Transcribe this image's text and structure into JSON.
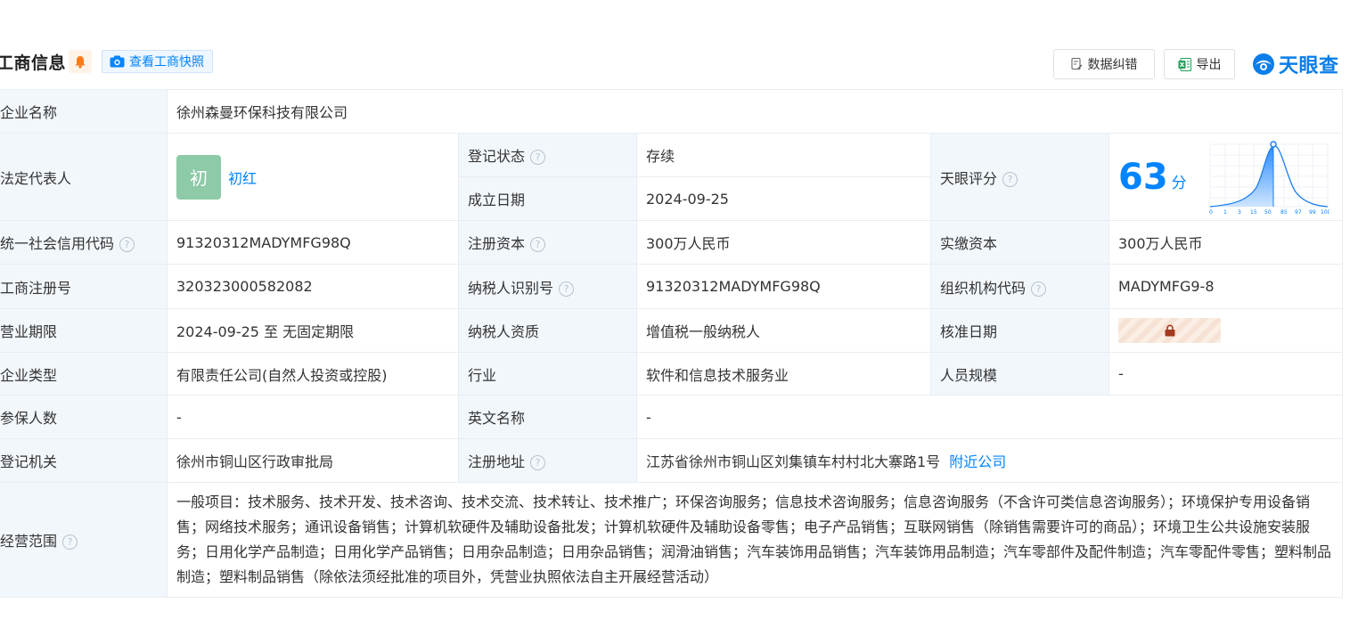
{
  "header": {
    "title": "工商信息",
    "snapshot_label": "查看工商快照",
    "error_label": "数据纠错",
    "export_label": "导出",
    "logo_text": "天眼查"
  },
  "colors": {
    "accent": "#0084ff",
    "status_green": "#0a9b46",
    "label_bg": "#f2f7fc",
    "avatar_bg": "#8dcaa7"
  },
  "company": {
    "name_label": "企业名称",
    "name": "徐州森曼环保科技有限公司",
    "legal_label": "法定代表人",
    "legal_avatar": "初",
    "legal_name": "初红",
    "status_label": "登记状态",
    "status": "存续",
    "founded_label": "成立日期",
    "founded": "2024-09-25",
    "score_label": "天眼评分",
    "score": "63",
    "score_unit": "分",
    "score_axis": [
      "0",
      "1",
      "3",
      "15",
      "50",
      "85",
      "97",
      "99",
      "100"
    ],
    "credit_code_label": "统一社会信用代码",
    "credit_code": "91320312MADYMFG98Q",
    "reg_capital_label": "注册资本",
    "reg_capital": "300万人民币",
    "paid_capital_label": "实缴资本",
    "paid_capital": "300万人民币",
    "reg_no_label": "工商注册号",
    "reg_no": "320323000582082",
    "taxpayer_id_label": "纳税人识别号",
    "taxpayer_id": "91320312MADYMFG98Q",
    "org_code_label": "组织机构代码",
    "org_code": "MADYMFG9-8",
    "term_label": "营业期限",
    "term": "2024-09-25 至 无固定期限",
    "taxpayer_type_label": "纳税人资质",
    "taxpayer_type": "增值税一般纳税人",
    "approval_label": "核准日期",
    "type_label": "企业类型",
    "type": "有限责任公司(自然人投资或控股)",
    "industry_label": "行业",
    "industry": "软件和信息技术服务业",
    "staff_label": "人员规模",
    "staff": "-",
    "insured_label": "参保人数",
    "insured": "-",
    "english_label": "英文名称",
    "english": "-",
    "authority_label": "登记机关",
    "authority": "徐州市铜山区行政审批局",
    "address_label": "注册地址",
    "address": "江苏省徐州市铜山区刘集镇车村村北大寨路1号",
    "nearby_label": "附近公司",
    "scope_label": "经营范围",
    "scope": "一般项目：技术服务、技术开发、技术咨询、技术交流、技术转让、技术推广；环保咨询服务；信息技术咨询服务；信息咨询服务（不含许可类信息咨询服务）；环境保护专用设备销售；网络技术服务；通讯设备销售；计算机软硬件及辅助设备批发；计算机软硬件及辅助设备零售；电子产品销售；互联网销售（除销售需要许可的商品）；环境卫生公共设施安装服务；日用化学产品制造；日用化学产品销售；日用杂品制造；日用杂品销售；润滑油销售；汽车装饰用品销售；汽车装饰用品制造；汽车零部件及配件制造；汽车零配件零售；塑料制品制造；塑料制品销售（除依法须经批准的项目外，凭营业执照依法自主开展经营活动）"
  }
}
